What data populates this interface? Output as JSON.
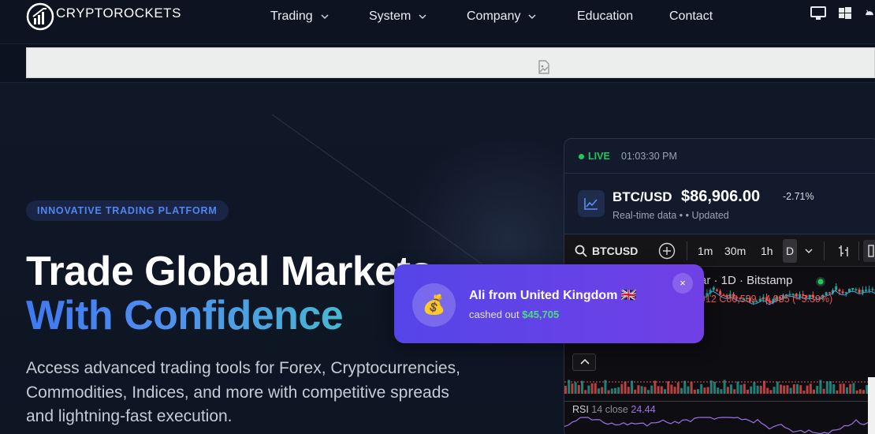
{
  "nav": {
    "logo_text": "CRYPTOROCKETS",
    "menu": [
      {
        "label": "Trading",
        "has_dropdown": true
      },
      {
        "label": "System",
        "has_dropdown": true
      },
      {
        "label": "Company",
        "has_dropdown": true
      },
      {
        "label": "Education",
        "has_dropdown": false
      },
      {
        "label": "Contact",
        "has_dropdown": false
      }
    ],
    "platform_icons": [
      "desktop-icon",
      "windows-icon",
      "android-icon"
    ]
  },
  "banner": {
    "icon": "broken-image-icon"
  },
  "hero": {
    "badge": "INNOVATIVE TRADING PLATFORM",
    "title_line1": "Trade Global Markets",
    "title_line2": "With Confidence",
    "description": "Access advanced trading tools for Forex, Cryptocurrencies, Commodities, Indices, and more with competitive spreads and lightning-fast execution."
  },
  "ticker_panel": {
    "live_label": "LIVE",
    "time": "01:03:30 PM",
    "symbol": "BTC/USD",
    "price": "$86,906.00",
    "change": "-2.71%",
    "subtitle": "Real-time data •  • Updated"
  },
  "tv_widget": {
    "symbol": "BTCUSD",
    "intervals": [
      "1m",
      "30m",
      "1h"
    ],
    "selected_interval": "D",
    "chart_title": "ar · 1D · Bitstamp",
    "ohlc": "912  C86,539  −4,935 (−5.39%)",
    "rsi_label": "RSI",
    "rsi_params": "14 close",
    "rsi_value": "24.44"
  },
  "toast": {
    "name": "Ali from United Kingdom 🇬🇧",
    "prefix": "cashed out",
    "amount": "$45,705",
    "avatar_emoji": "💰",
    "close_symbol": "×"
  },
  "colors": {
    "background": "#0c1220",
    "accent_blue": "#3e79f0",
    "accent_teal": "#47b7d1",
    "live_green": "#23c55e",
    "toast_purple": "#5545e8",
    "amount_green": "#4ade80"
  }
}
